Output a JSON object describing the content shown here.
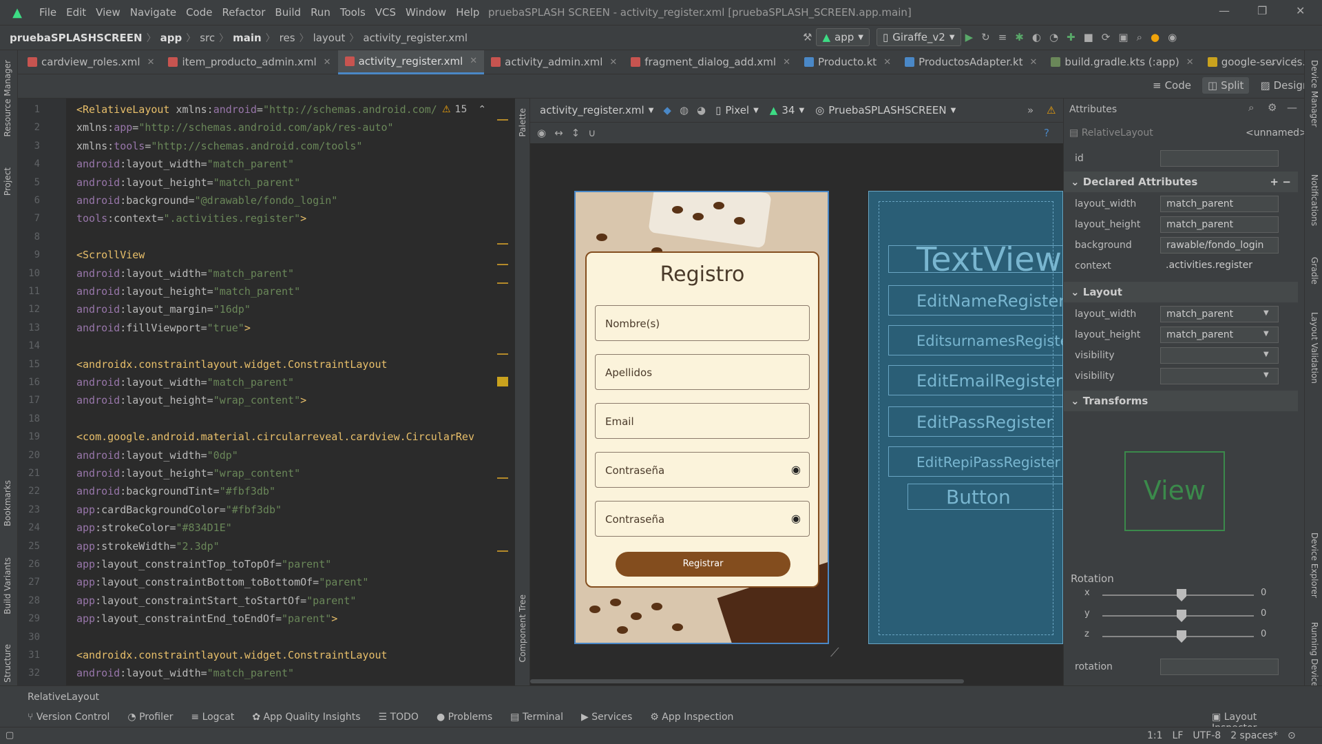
{
  "app_title": "pruebaSPLASH SCREEN - activity_register.xml [pruebaSPLASH_SCREEN.app.main]",
  "menu": [
    "File",
    "Edit",
    "View",
    "Navigate",
    "Code",
    "Refactor",
    "Build",
    "Run",
    "Tools",
    "VCS",
    "Window",
    "Help"
  ],
  "breadcrumb": [
    "pruebaSPLASHSCREEN",
    "app",
    "src",
    "main",
    "res",
    "layout",
    "activity_register.xml"
  ],
  "run_config": "app",
  "device": "Giraffe_v2",
  "tabs": [
    "cardview_roles.xml",
    "item_producto_admin.xml",
    "activity_register.xml",
    "activity_admin.xml",
    "fragment_dialog_add.xml",
    "Producto.kt",
    "ProductosAdapter.kt",
    "build.gradle.kts (:app)",
    "google-services.json"
  ],
  "view_modes": [
    "Code",
    "Split",
    "Design"
  ],
  "left_tools": [
    "Resource Manager",
    "Project",
    "Bookmarks",
    "Build Variants",
    "Structure"
  ],
  "right_tools": [
    "Device Manager",
    "Notifications",
    "Gradle",
    "Layout Validation",
    "Device Explorer",
    "Running Devices"
  ],
  "warnings_count": "15",
  "code_lines": [
    {
      "n": "1",
      "t": [
        [
          "tag",
          "<RelativeLayout "
        ],
        [
          "attr",
          "xmlns:"
        ],
        [
          "ns",
          "android"
        ],
        [
          "attr",
          "="
        ],
        [
          "str",
          "\"http://schemas.android.com/"
        ]
      ]
    },
    {
      "n": "2",
      "t": [
        [
          "attr",
          "    xmlns:"
        ],
        [
          "ns",
          "app"
        ],
        [
          "attr",
          "="
        ],
        [
          "str",
          "\"http://schemas.android.com/apk/res-auto\""
        ]
      ]
    },
    {
      "n": "3",
      "t": [
        [
          "attr",
          "    xmlns:"
        ],
        [
          "ns",
          "tools"
        ],
        [
          "attr",
          "="
        ],
        [
          "str",
          "\"http://schemas.android.com/tools\""
        ]
      ]
    },
    {
      "n": "4",
      "t": [
        [
          "ns",
          "    android"
        ],
        [
          "attr",
          ":layout_width="
        ],
        [
          "str",
          "\"match_parent\""
        ]
      ]
    },
    {
      "n": "5",
      "t": [
        [
          "ns",
          "    android"
        ],
        [
          "attr",
          ":layout_height="
        ],
        [
          "str",
          "\"match_parent\""
        ]
      ]
    },
    {
      "n": "6",
      "t": [
        [
          "ns",
          "    android"
        ],
        [
          "attr",
          ":background="
        ],
        [
          "str",
          "\"@drawable/fondo_login\""
        ]
      ]
    },
    {
      "n": "7",
      "t": [
        [
          "ns",
          "    tools"
        ],
        [
          "attr",
          ":context="
        ],
        [
          "str",
          "\".activities.register\""
        ],
        [
          "tag",
          ">"
        ]
      ]
    },
    {
      "n": "8",
      "t": []
    },
    {
      "n": "9",
      "t": [
        [
          "tag",
          "  <ScrollView"
        ]
      ]
    },
    {
      "n": "10",
      "t": [
        [
          "ns",
          "      android"
        ],
        [
          "attr",
          ":layout_width="
        ],
        [
          "str",
          "\"match_parent\""
        ]
      ]
    },
    {
      "n": "11",
      "t": [
        [
          "ns",
          "      android"
        ],
        [
          "attr",
          ":layout_height="
        ],
        [
          "str",
          "\"match_parent\""
        ]
      ]
    },
    {
      "n": "12",
      "t": [
        [
          "ns",
          "      android"
        ],
        [
          "attr",
          ":layout_margin="
        ],
        [
          "str",
          "\"16dp\""
        ]
      ]
    },
    {
      "n": "13",
      "t": [
        [
          "ns",
          "      android"
        ],
        [
          "attr",
          ":fillViewport="
        ],
        [
          "str",
          "\"true\""
        ],
        [
          "tag",
          ">"
        ]
      ]
    },
    {
      "n": "14",
      "t": []
    },
    {
      "n": "15",
      "t": [
        [
          "tag",
          "    <androidx.constraintlayout.widget.ConstraintLayout"
        ]
      ]
    },
    {
      "n": "16",
      "t": [
        [
          "ns",
          "        android"
        ],
        [
          "attr",
          ":layout_width="
        ],
        [
          "str",
          "\"match_parent\""
        ]
      ]
    },
    {
      "n": "17",
      "t": [
        [
          "ns",
          "        android"
        ],
        [
          "attr",
          ":layout_height="
        ],
        [
          "str",
          "\"wrap_content\""
        ],
        [
          "tag",
          ">"
        ]
      ]
    },
    {
      "n": "18",
      "t": []
    },
    {
      "n": "19",
      "t": [
        [
          "tag",
          "      <com.google.android.material.circularreveal.cardview.CircularRev"
        ]
      ]
    },
    {
      "n": "20",
      "t": [
        [
          "ns",
          "          android"
        ],
        [
          "attr",
          ":layout_width="
        ],
        [
          "str",
          "\"0dp\""
        ]
      ]
    },
    {
      "n": "21",
      "t": [
        [
          "ns",
          "          android"
        ],
        [
          "attr",
          ":layout_height="
        ],
        [
          "str",
          "\"wrap_content\""
        ]
      ]
    },
    {
      "n": "22",
      "t": [
        [
          "ns",
          "          android"
        ],
        [
          "attr",
          ":backgroundTint="
        ],
        [
          "str",
          "\"#fbf3db\""
        ]
      ]
    },
    {
      "n": "23",
      "t": [
        [
          "ns",
          "          app"
        ],
        [
          "attr",
          ":cardBackgroundColor="
        ],
        [
          "str",
          "\"#fbf3db\""
        ]
      ]
    },
    {
      "n": "24",
      "t": [
        [
          "ns",
          "          app"
        ],
        [
          "attr",
          ":strokeColor="
        ],
        [
          "str",
          "\"#834D1E\""
        ]
      ]
    },
    {
      "n": "25",
      "t": [
        [
          "ns",
          "          app"
        ],
        [
          "attr",
          ":strokeWidth="
        ],
        [
          "str",
          "\"2.3dp\""
        ]
      ]
    },
    {
      "n": "26",
      "t": [
        [
          "ns",
          "          app"
        ],
        [
          "attr",
          ":layout_constraintTop_toTopOf="
        ],
        [
          "str",
          "\"parent\""
        ]
      ]
    },
    {
      "n": "27",
      "t": [
        [
          "ns",
          "          app"
        ],
        [
          "attr",
          ":layout_constraintBottom_toBottomOf="
        ],
        [
          "str",
          "\"parent\""
        ]
      ]
    },
    {
      "n": "28",
      "t": [
        [
          "ns",
          "          app"
        ],
        [
          "attr",
          ":layout_constraintStart_toStartOf="
        ],
        [
          "str",
          "\"parent\""
        ]
      ]
    },
    {
      "n": "29",
      "t": [
        [
          "ns",
          "          app"
        ],
        [
          "attr",
          ":layout_constraintEnd_toEndOf="
        ],
        [
          "str",
          "\"parent\""
        ],
        [
          "tag",
          ">"
        ]
      ]
    },
    {
      "n": "30",
      "t": []
    },
    {
      "n": "31",
      "t": [
        [
          "tag",
          "        <androidx.constraintlayout.widget.ConstraintLayout"
        ]
      ]
    },
    {
      "n": "32",
      "t": [
        [
          "ns",
          "            android"
        ],
        [
          "attr",
          ":layout_width="
        ],
        [
          "str",
          "\"match_parent\""
        ]
      ]
    }
  ],
  "designer": {
    "file": "activity_register.xml",
    "device": "Pixel",
    "api": "34",
    "theme": "PruebaSPLASHSCREEN"
  },
  "preview": {
    "title": "Registro",
    "fields": [
      "Nombre(s)",
      "Apellidos",
      "Email",
      "Contraseña",
      "Contraseña"
    ],
    "button": "Registrar"
  },
  "blueprint": [
    "TextView",
    "EditNameRegister",
    "EditsurnamesRegister",
    "EditEmailRegister",
    "EditPassRegister",
    "EditRepiPassRegister",
    "Button"
  ],
  "attributes": {
    "header": "Attributes",
    "component": "RelativeLayout",
    "component_name": "<unnamed>",
    "id_label": "id",
    "declared_title": "Declared Attributes",
    "declared": [
      {
        "k": "layout_width",
        "v": "match_parent"
      },
      {
        "k": "layout_height",
        "v": "match_parent"
      },
      {
        "k": "background",
        "v": "rawable/fondo_login"
      },
      {
        "k": "context",
        "v": ".activities.register"
      }
    ],
    "layout_title": "Layout",
    "layout": [
      {
        "k": "layout_width",
        "v": "match_parent"
      },
      {
        "k": "layout_height",
        "v": "match_parent"
      },
      {
        "k": "visibility",
        "v": ""
      },
      {
        "k": "visibility",
        "v": ""
      }
    ],
    "transforms_title": "Transforms",
    "view_label": "View",
    "rotation_title": "Rotation",
    "rotation": [
      {
        "k": "x",
        "v": "0"
      },
      {
        "k": "y",
        "v": "0"
      },
      {
        "k": "z",
        "v": "0"
      }
    ],
    "rotation_field": "rotation"
  },
  "status_component": "RelativeLayout",
  "tool_windows": [
    "Version Control",
    "Profiler",
    "Logcat",
    "App Quality Insights",
    "TODO",
    "Problems",
    "Terminal",
    "Services",
    "App Inspection"
  ],
  "layout_inspector": "Layout Inspector",
  "status_right": [
    "1:1",
    "LF",
    "UTF-8",
    "2 spaces*"
  ]
}
